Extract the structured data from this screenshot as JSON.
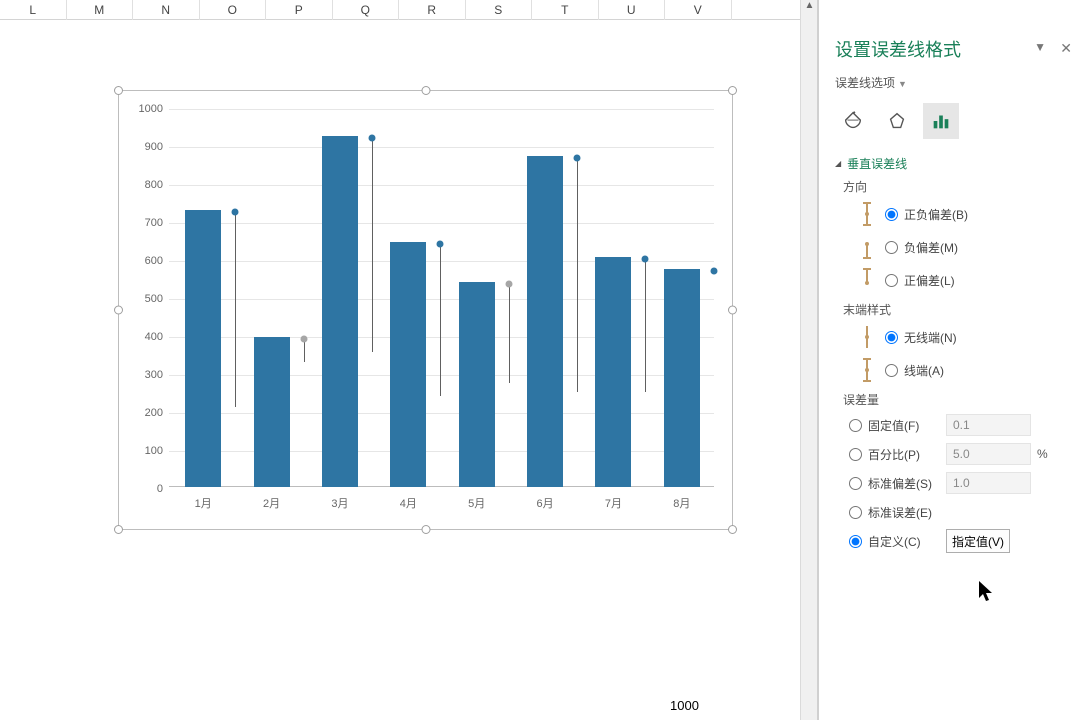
{
  "columns": [
    "L",
    "M",
    "N",
    "O",
    "P",
    "Q",
    "R",
    "S",
    "T",
    "U",
    "V"
  ],
  "pane": {
    "title": "设置误差线格式",
    "subtitle": "误差线选项",
    "section_vertical": "垂直误差线",
    "direction_label": "方向",
    "direction": {
      "both": "正负偏差(B)",
      "minus": "负偏差(M)",
      "plus": "正偏差(L)"
    },
    "endstyle_label": "末端样式",
    "endstyle": {
      "none": "无线端(N)",
      "cap": "线端(A)"
    },
    "amount_label": "误差量",
    "amount": {
      "fixed": "固定值(F)",
      "pct": "百分比(P)",
      "stdev": "标准偏差(S)",
      "stderr": "标准误差(E)",
      "custom": "自定义(C)",
      "specify_btn": "指定值(V)",
      "fixed_val": "0.1",
      "pct_val": "5.0",
      "stdev_val": "1.0",
      "pct_unit": "%"
    }
  },
  "chart_data": {
    "type": "bar",
    "categories": [
      "1月",
      "2月",
      "3月",
      "4月",
      "5月",
      "6月",
      "7月",
      "8月"
    ],
    "values": [
      730,
      395,
      925,
      645,
      540,
      870,
      605,
      575
    ],
    "error_plus": [
      0,
      0,
      0,
      0,
      0,
      0,
      0,
      0
    ],
    "error_minus": [
      515,
      60,
      565,
      400,
      260,
      615,
      350,
      0
    ],
    "marker_color": [
      "blue",
      "grey",
      "blue",
      "blue",
      "grey",
      "blue",
      "blue",
      "blue"
    ],
    "ylim": [
      0,
      1000
    ],
    "ytick_step": 100,
    "title": "",
    "xlabel": "",
    "ylabel": ""
  },
  "stray_bottom_text": "1000"
}
